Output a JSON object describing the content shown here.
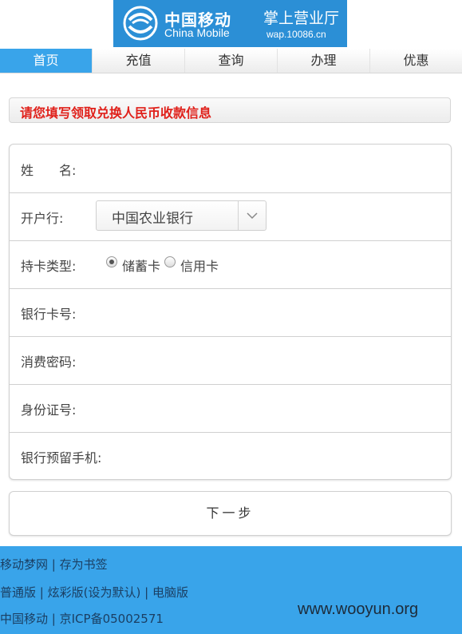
{
  "header": {
    "brand_cn": "中国移动",
    "brand_en": "China Mobile",
    "hall": "掌上营业厅",
    "domain": "wap.10086.cn"
  },
  "nav": [
    "首页",
    "充值",
    "查询",
    "办理",
    "优惠"
  ],
  "notice": "请您填写领取兑换人民币收款信息",
  "form": {
    "name_label": "姓　　名:",
    "bank_label": "开户行:",
    "bank_value": "中国农业银行",
    "card_type_label": "持卡类型:",
    "card_type_options": [
      "储蓄卡",
      "信用卡"
    ],
    "card_type_selected": "储蓄卡",
    "card_no_label": "银行卡号:",
    "pin_label": "消费密码:",
    "id_label": "身份证号:",
    "phone_label": "银行预留手机:"
  },
  "next_button": "下一步",
  "footer": {
    "line1": [
      "移动梦网",
      "存为书签"
    ],
    "line2": [
      "普通版",
      "炫彩版",
      "(设为默认)",
      "电脑版"
    ],
    "line3": [
      "中国移动",
      "京ICP备05002571"
    ]
  },
  "watermark": "www.wooyun.org",
  "colors": {
    "accent": "#39a4ea",
    "notice_text": "#e0201a"
  }
}
